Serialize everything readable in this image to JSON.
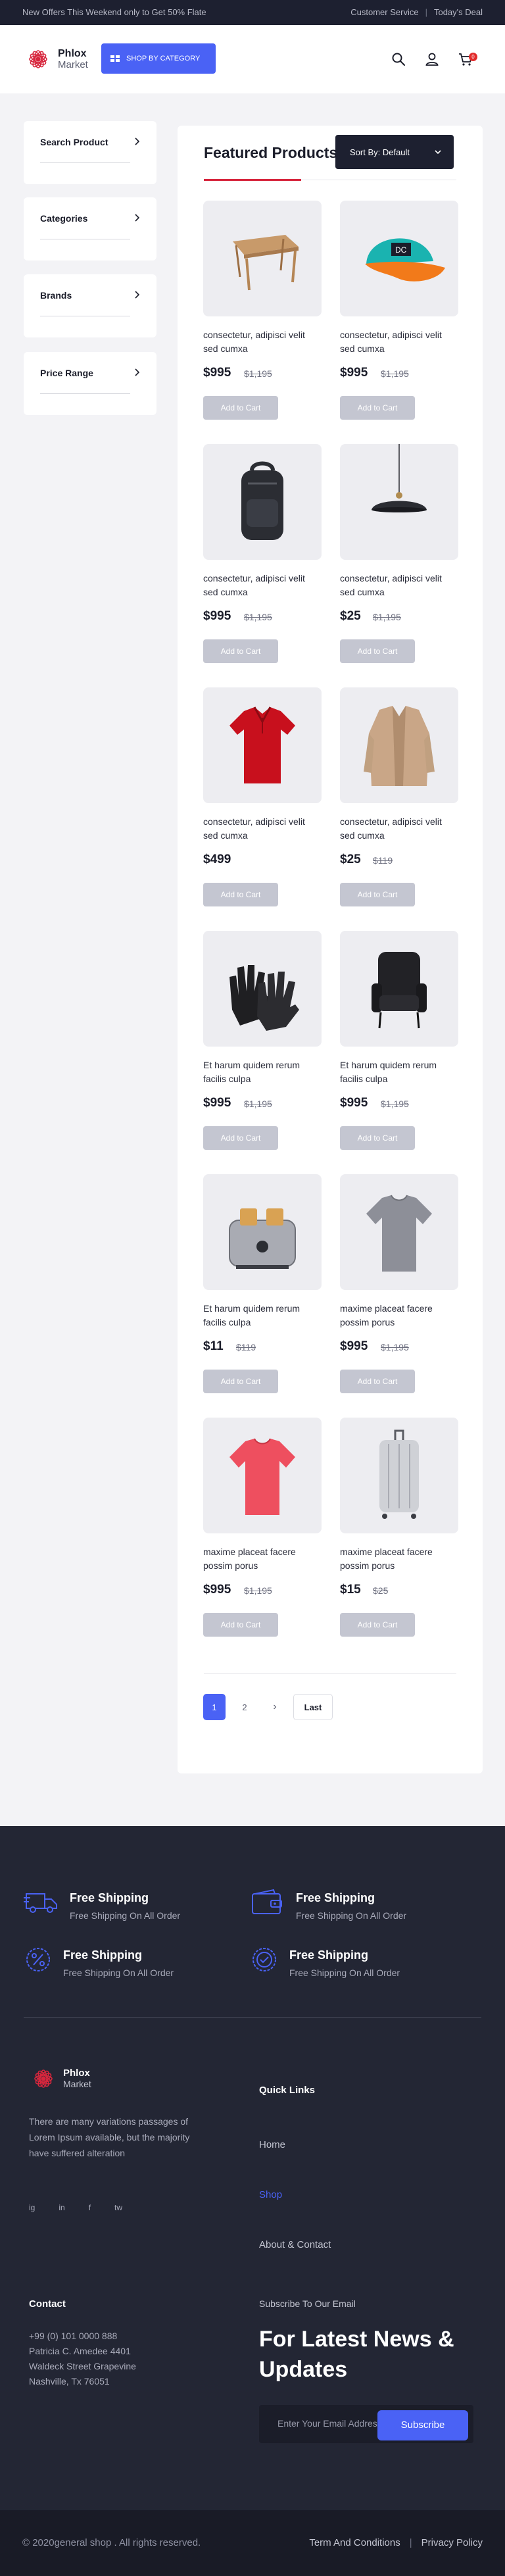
{
  "topbar": {
    "promo": "New Offers This Weekend only to Get 50% Flate",
    "customer_service": "Customer Service",
    "separator": "|",
    "todays_deal": "Today's Deal"
  },
  "header": {
    "logo_name": "Phlox",
    "logo_sub": "Market",
    "shop_by_category": "SHOP BY CATEGORY",
    "cart_count": "0",
    "brand_color": "#4a62f5",
    "accent_color": "#d7263d"
  },
  "sidebar": {
    "filters": [
      {
        "label": "Search Product"
      },
      {
        "label": "Categories"
      },
      {
        "label": "Brands"
      },
      {
        "label": "Price Range"
      }
    ]
  },
  "main": {
    "title": "Featured Products",
    "sort_label": "Sort By: Default",
    "add_to_cart": "Add to Cart",
    "products": [
      {
        "name": "consectetur, adipisci velit sed cumxa",
        "price": "$995",
        "old_price": "$1,195",
        "icon": "wooden-table"
      },
      {
        "name": "consectetur, adipisci velit sed cumxa",
        "price": "$995",
        "old_price": "$1,195",
        "icon": "cap"
      },
      {
        "name": "consectetur, adipisci velit sed cumxa",
        "price": "$995",
        "old_price": "$1,195",
        "icon": "backpack"
      },
      {
        "name": "consectetur, adipisci velit sed cumxa",
        "price": "$25",
        "old_price": "$1,195",
        "icon": "pendant-lamp"
      },
      {
        "name": "consectetur, adipisci velit sed cumxa",
        "price": "$499",
        "old_price": "",
        "icon": "polo-shirt"
      },
      {
        "name": "consectetur, adipisci velit sed cumxa",
        "price": "$25",
        "old_price": "$119",
        "icon": "fur-coat"
      },
      {
        "name": "Et harum quidem rerum facilis culpa",
        "price": "$995",
        "old_price": "$1,195",
        "icon": "gloves"
      },
      {
        "name": "Et harum quidem rerum facilis culpa",
        "price": "$995",
        "old_price": "$1,195",
        "icon": "armchair"
      },
      {
        "name": "Et harum quidem rerum facilis culpa",
        "price": "$11",
        "old_price": "$119",
        "icon": "toaster"
      },
      {
        "name": "maxime placeat facere possim porus",
        "price": "$995",
        "old_price": "$1,195",
        "icon": "grey-tshirt"
      },
      {
        "name": "maxime placeat facere possim porus",
        "price": "$995",
        "old_price": "$1,195",
        "icon": "pink-tshirt"
      },
      {
        "name": "maxime placeat facere possim porus",
        "price": "$15",
        "old_price": "$25",
        "icon": "suitcase"
      }
    ],
    "pagination": {
      "pages": [
        "1",
        "2"
      ],
      "next": "›",
      "last": "Last",
      "current": "1"
    }
  },
  "footer": {
    "features": [
      {
        "title": "Free Shipping",
        "subtitle": "Free Shipping On All Order",
        "icon": "truck-icon"
      },
      {
        "title": "Free Shipping",
        "subtitle": "Free Shipping On All Order",
        "icon": "wallet-icon"
      },
      {
        "title": "Free Shipping",
        "subtitle": "Free Shipping On All Order",
        "icon": "percent-badge-icon"
      },
      {
        "title": "Free Shipping",
        "subtitle": "Free Shipping On All Order",
        "icon": "check-badge-icon"
      }
    ],
    "logo_name": "Phlox",
    "logo_sub": "Market",
    "description": "There are many variations passages of Lorem Ipsum available, but the majority have suffered alteration",
    "socials": [
      "ig",
      "in",
      "f",
      "tw"
    ],
    "quick_links_title": "Quick Links",
    "quick_links": [
      "Home",
      "Shop",
      "About & Contact"
    ],
    "active_link": "Shop",
    "contact_title": "Contact",
    "contact_lines": [
      "+99 (0) 101 0000 888",
      "Patricia C. Amedee 4401",
      "Waldeck Street Grapevine",
      "Nashville, Tx 76051"
    ],
    "subscribe_label": "Subscribe To Our Email",
    "subscribe_heading": "For Latest News & Updates",
    "email_placeholder": "Enter Your Email Address",
    "subscribe_button": "Subscribe",
    "copyright": "© 2020general shop . All rights reserved.",
    "terms": "Term And Conditions",
    "privacy": "Privacy Policy",
    "separator": "|"
  }
}
